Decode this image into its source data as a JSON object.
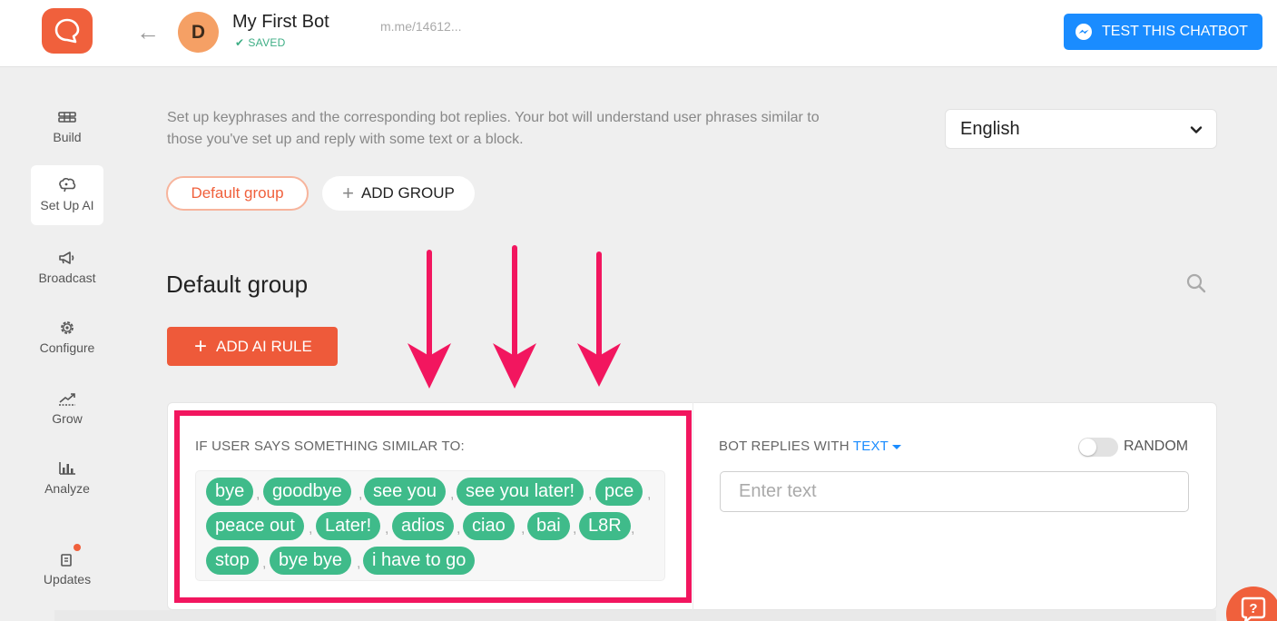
{
  "header": {
    "bot_initial": "D",
    "bot_name": "My First Bot",
    "saved_status": "SAVED",
    "bot_link": "m.me/14612...",
    "test_button_label": "TEST THIS CHATBOT",
    "brand_color": "#f0603c",
    "messenger_color": "#1a8cff"
  },
  "sidebar": {
    "items": [
      {
        "label": "Build",
        "icon": "build-icon",
        "active": false
      },
      {
        "label": "Set Up AI",
        "icon": "ai-brain-icon",
        "active": true
      },
      {
        "label": "Broadcast",
        "icon": "megaphone-icon",
        "active": false
      },
      {
        "label": "Configure",
        "icon": "gear-icon",
        "active": false
      },
      {
        "label": "Grow",
        "icon": "grow-chart-icon",
        "active": false
      },
      {
        "label": "Analyze",
        "icon": "bar-chart-icon",
        "active": false
      },
      {
        "label": "Updates",
        "icon": "updates-icon",
        "active": false,
        "notification": true
      }
    ]
  },
  "main": {
    "intro_text": "Set up keyphrases and the corresponding bot replies. Your bot will understand user phrases similar to those you've set up and reply with some text or a block.",
    "language": "English",
    "groups": {
      "active_label": "Default group",
      "add_label": "ADD GROUP"
    },
    "section_title": "Default group",
    "add_rule_label": "ADD AI RULE"
  },
  "rule": {
    "if_label": "IF USER SAYS SOMETHING SIMILAR TO:",
    "phrases": [
      "bye",
      "goodbye",
      "see you",
      "see you later!",
      "pce",
      "peace out",
      "Later!",
      "adios",
      "ciao",
      "bai",
      "L8R",
      "stop",
      "bye bye",
      "i have to go"
    ],
    "replies_prefix": "BOT REPLIES WITH",
    "replies_type": "TEXT",
    "random_label": "RANDOM",
    "random_enabled": false,
    "reply_placeholder": "Enter text",
    "chip_color": "#3fbb8a",
    "highlight_color": "#f2165f"
  }
}
